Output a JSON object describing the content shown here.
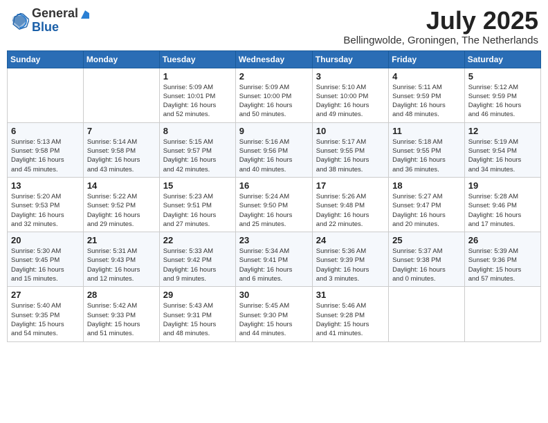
{
  "header": {
    "logo_general": "General",
    "logo_blue": "Blue",
    "month_title": "July 2025",
    "subtitle": "Bellingwolde, Groningen, The Netherlands"
  },
  "days_of_week": [
    "Sunday",
    "Monday",
    "Tuesday",
    "Wednesday",
    "Thursday",
    "Friday",
    "Saturday"
  ],
  "weeks": [
    [
      {
        "day": "",
        "info": ""
      },
      {
        "day": "",
        "info": ""
      },
      {
        "day": "1",
        "info": "Sunrise: 5:09 AM\nSunset: 10:01 PM\nDaylight: 16 hours\nand 52 minutes."
      },
      {
        "day": "2",
        "info": "Sunrise: 5:09 AM\nSunset: 10:00 PM\nDaylight: 16 hours\nand 50 minutes."
      },
      {
        "day": "3",
        "info": "Sunrise: 5:10 AM\nSunset: 10:00 PM\nDaylight: 16 hours\nand 49 minutes."
      },
      {
        "day": "4",
        "info": "Sunrise: 5:11 AM\nSunset: 9:59 PM\nDaylight: 16 hours\nand 48 minutes."
      },
      {
        "day": "5",
        "info": "Sunrise: 5:12 AM\nSunset: 9:59 PM\nDaylight: 16 hours\nand 46 minutes."
      }
    ],
    [
      {
        "day": "6",
        "info": "Sunrise: 5:13 AM\nSunset: 9:58 PM\nDaylight: 16 hours\nand 45 minutes."
      },
      {
        "day": "7",
        "info": "Sunrise: 5:14 AM\nSunset: 9:58 PM\nDaylight: 16 hours\nand 43 minutes."
      },
      {
        "day": "8",
        "info": "Sunrise: 5:15 AM\nSunset: 9:57 PM\nDaylight: 16 hours\nand 42 minutes."
      },
      {
        "day": "9",
        "info": "Sunrise: 5:16 AM\nSunset: 9:56 PM\nDaylight: 16 hours\nand 40 minutes."
      },
      {
        "day": "10",
        "info": "Sunrise: 5:17 AM\nSunset: 9:55 PM\nDaylight: 16 hours\nand 38 minutes."
      },
      {
        "day": "11",
        "info": "Sunrise: 5:18 AM\nSunset: 9:55 PM\nDaylight: 16 hours\nand 36 minutes."
      },
      {
        "day": "12",
        "info": "Sunrise: 5:19 AM\nSunset: 9:54 PM\nDaylight: 16 hours\nand 34 minutes."
      }
    ],
    [
      {
        "day": "13",
        "info": "Sunrise: 5:20 AM\nSunset: 9:53 PM\nDaylight: 16 hours\nand 32 minutes."
      },
      {
        "day": "14",
        "info": "Sunrise: 5:22 AM\nSunset: 9:52 PM\nDaylight: 16 hours\nand 29 minutes."
      },
      {
        "day": "15",
        "info": "Sunrise: 5:23 AM\nSunset: 9:51 PM\nDaylight: 16 hours\nand 27 minutes."
      },
      {
        "day": "16",
        "info": "Sunrise: 5:24 AM\nSunset: 9:50 PM\nDaylight: 16 hours\nand 25 minutes."
      },
      {
        "day": "17",
        "info": "Sunrise: 5:26 AM\nSunset: 9:48 PM\nDaylight: 16 hours\nand 22 minutes."
      },
      {
        "day": "18",
        "info": "Sunrise: 5:27 AM\nSunset: 9:47 PM\nDaylight: 16 hours\nand 20 minutes."
      },
      {
        "day": "19",
        "info": "Sunrise: 5:28 AM\nSunset: 9:46 PM\nDaylight: 16 hours\nand 17 minutes."
      }
    ],
    [
      {
        "day": "20",
        "info": "Sunrise: 5:30 AM\nSunset: 9:45 PM\nDaylight: 16 hours\nand 15 minutes."
      },
      {
        "day": "21",
        "info": "Sunrise: 5:31 AM\nSunset: 9:43 PM\nDaylight: 16 hours\nand 12 minutes."
      },
      {
        "day": "22",
        "info": "Sunrise: 5:33 AM\nSunset: 9:42 PM\nDaylight: 16 hours\nand 9 minutes."
      },
      {
        "day": "23",
        "info": "Sunrise: 5:34 AM\nSunset: 9:41 PM\nDaylight: 16 hours\nand 6 minutes."
      },
      {
        "day": "24",
        "info": "Sunrise: 5:36 AM\nSunset: 9:39 PM\nDaylight: 16 hours\nand 3 minutes."
      },
      {
        "day": "25",
        "info": "Sunrise: 5:37 AM\nSunset: 9:38 PM\nDaylight: 16 hours\nand 0 minutes."
      },
      {
        "day": "26",
        "info": "Sunrise: 5:39 AM\nSunset: 9:36 PM\nDaylight: 15 hours\nand 57 minutes."
      }
    ],
    [
      {
        "day": "27",
        "info": "Sunrise: 5:40 AM\nSunset: 9:35 PM\nDaylight: 15 hours\nand 54 minutes."
      },
      {
        "day": "28",
        "info": "Sunrise: 5:42 AM\nSunset: 9:33 PM\nDaylight: 15 hours\nand 51 minutes."
      },
      {
        "day": "29",
        "info": "Sunrise: 5:43 AM\nSunset: 9:31 PM\nDaylight: 15 hours\nand 48 minutes."
      },
      {
        "day": "30",
        "info": "Sunrise: 5:45 AM\nSunset: 9:30 PM\nDaylight: 15 hours\nand 44 minutes."
      },
      {
        "day": "31",
        "info": "Sunrise: 5:46 AM\nSunset: 9:28 PM\nDaylight: 15 hours\nand 41 minutes."
      },
      {
        "day": "",
        "info": ""
      },
      {
        "day": "",
        "info": ""
      }
    ]
  ]
}
